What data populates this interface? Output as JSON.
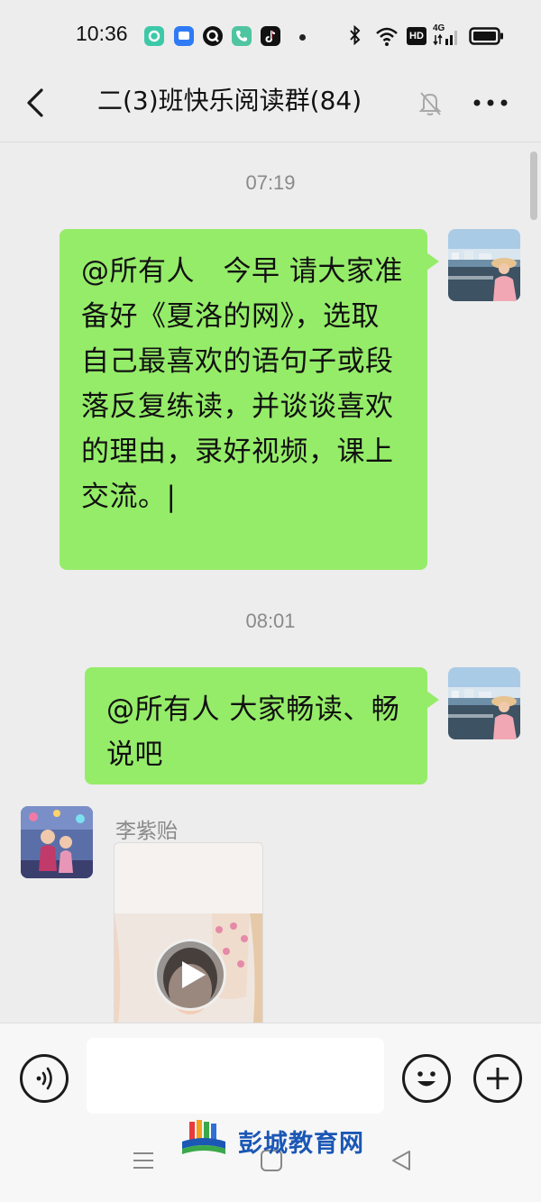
{
  "status_bar": {
    "time": "10:36",
    "app_icons": [
      "app-icon-1",
      "messages-icon",
      "q-icon",
      "phone-icon",
      "tiktok-icon"
    ],
    "system_icons": [
      "bluetooth-icon",
      "wifi-icon",
      "hd-icon",
      "4g-signal-icon",
      "battery-icon"
    ],
    "hd_label": "HD",
    "network_label": "4G"
  },
  "header": {
    "title": "二(3)班快乐阅读群(84)",
    "muted": true
  },
  "messages": [
    {
      "timestamp": "07:19",
      "sender": "self",
      "text": "@所有人　今早 请大家准备好《夏洛的网》，选取自己最喜欢的语句子或段落反复练读，并谈谈喜欢的理由，录好视频，课上交流。|"
    },
    {
      "timestamp": "08:01",
      "sender": "self",
      "text": "@所有人  大家畅读、畅说吧"
    },
    {
      "sender": "李紫贻",
      "type": "video"
    }
  ],
  "input_bar": {
    "value": "",
    "placeholder": ""
  },
  "watermark": {
    "text": "彭城教育网"
  },
  "colors": {
    "bubble": "#95ec69",
    "background": "#ededed",
    "input_bar": "#f7f7f7"
  }
}
